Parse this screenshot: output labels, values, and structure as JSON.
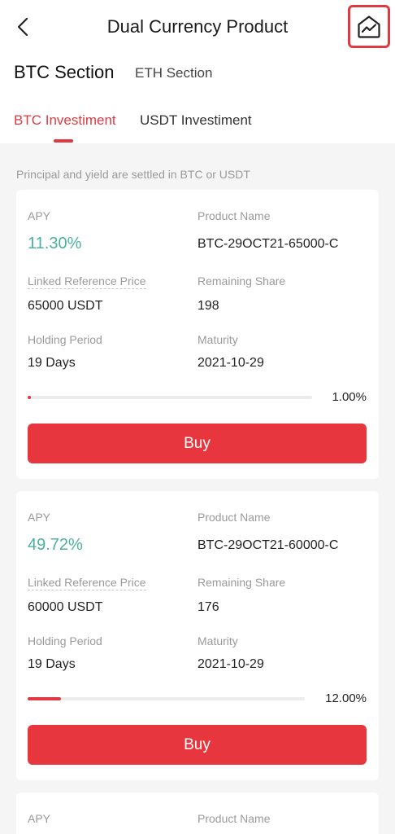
{
  "header": {
    "title": "Dual Currency Product",
    "back_icon": "chevron-left-icon",
    "chart_icon": "trend-chart-icon",
    "highlight_color": "#e03a40"
  },
  "section_tabs": [
    {
      "label": "BTC Section",
      "active": true
    },
    {
      "label": "ETH Section",
      "active": false
    }
  ],
  "investment_tabs": [
    {
      "label": "BTC Investiment",
      "active": true
    },
    {
      "label": "USDT Investiment",
      "active": false
    }
  ],
  "note": "Principal and yield are settled in BTC or USDT",
  "labels": {
    "apy": "APY",
    "product_name": "Product Name",
    "linked_price": "Linked Reference Price",
    "remaining_share": "Remaining Share",
    "holding_period": "Holding Period",
    "maturity": "Maturity",
    "buy": "Buy"
  },
  "products": [
    {
      "apy": "11.30%",
      "product_name": "BTC-29OCT21-65000-C",
      "linked_price": "65000 USDT",
      "remaining_share": "198",
      "holding_period": "19 Days",
      "maturity": "2021-10-29",
      "progress_text": "1.00%",
      "progress": 0.01
    },
    {
      "apy": "49.72%",
      "product_name": "BTC-29OCT21-60000-C",
      "linked_price": "60000 USDT",
      "remaining_share": "176",
      "holding_period": "19 Days",
      "maturity": "2021-10-29",
      "progress_text": "12.00%",
      "progress": 0.12
    }
  ],
  "colors": {
    "accent": "#e03a40",
    "apy": "#4bb19f",
    "buy_button": "#e8363e"
  }
}
